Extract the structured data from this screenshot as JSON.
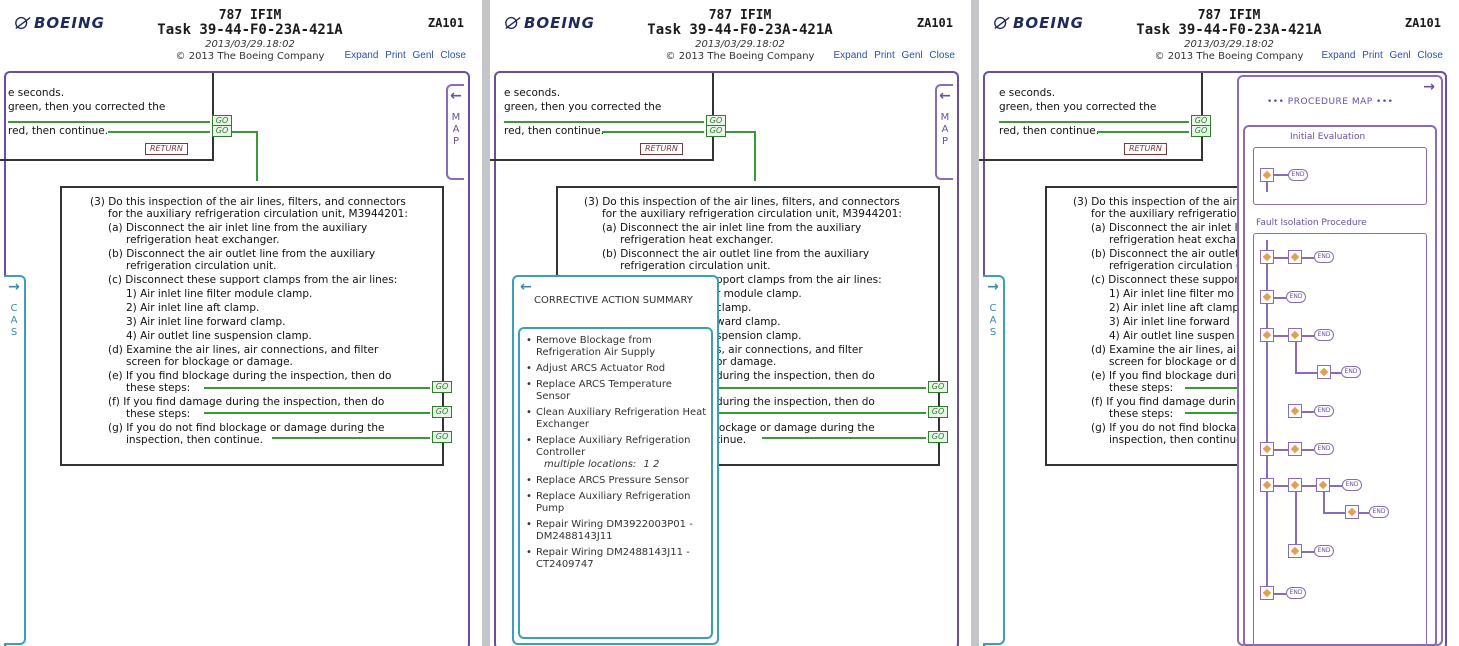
{
  "header": {
    "logo": "BOEING",
    "app_title": "787 IFIM",
    "task": "Task 39-44-F0-23A-421A",
    "date": "2013/03/29.18:02",
    "copyright": "© 2013 The Boeing Company",
    "id": "ZA101",
    "nav": [
      "Expand",
      "Print",
      "Genl",
      "Close"
    ]
  },
  "flow": {
    "line1": "e seconds.",
    "line2": "green, then you corrected the",
    "line3": "red, then continue.",
    "go": "GO",
    "return": "RETURN"
  },
  "step": {
    "s3a": "(3) Do this inspection of the air lines, filters, and connectors",
    "s3b": "for the auxiliary refrigeration circulation unit, M3944201:",
    "a1": "(a) Disconnect the air inlet line from the auxiliary",
    "a2": "refrigeration heat exchanger.",
    "b1": "(b) Disconnect the air outlet line from the auxiliary",
    "b2": "refrigeration circulation unit.",
    "c1": "(c) Disconnect these support clamps from the air lines:",
    "c_i1": "1) Air inlet line filter module clamp.",
    "c_i2": "2) Air inlet line aft clamp.",
    "c_i3": "3) Air inlet line forward clamp.",
    "c_i4": "4) Air outlet line suspension clamp.",
    "d1": "(d) Examine the air lines, air connections, and filter",
    "d2": "screen for blockage or damage.",
    "e1": "(e) If you find blockage during the inspection, then do",
    "e2": "these steps:",
    "f1": "(f) If you find damage during the inspection, then do",
    "f2": "these steps:",
    "g1": "(g) If you do not find blockage or damage during the",
    "g2": "inspection, then continue."
  },
  "p2step": {
    "c1": "pport clamps from the air lines:",
    "ci1": "r module clamp.",
    "ci2": "clamp.",
    "ci3": "ward clamp.",
    "ci4": "spension clamp.",
    "d1": "s, air connections, and filter",
    "d2": "or damage.",
    "e1": "during the inspection, then do",
    "f1": "during the inspection, then do",
    "g1": "lockage or damage during the",
    "g2": "tinue."
  },
  "p3step": {
    "s3a": "(3) Do this inspection of the air",
    "s3b": "for the auxiliary refrigeratio",
    "a1": "(a) Disconnect the air inlet li",
    "a2": "refrigeration heat exchar",
    "b1": "(b) Disconnect the air outlet",
    "b2": "refrigeration circulation (",
    "c1": "(c) Disconnect these suppor",
    "c_i1": "1) Air inlet line filter mo",
    "c_i2": "2) Air inlet line aft clamp",
    "c_i3": "3) Air inlet line forward",
    "c_i4": "4) Air outlet line suspen",
    "d1": "(d) Examine the air lines, ai",
    "d2": "screen for blockage or d",
    "e1": "(e) If you find blockage duri",
    "e2": "these steps:",
    "f1": "(f) If you find damage durin",
    "f2": "these steps:",
    "g1": "(g) If you do not find blocka",
    "g2": "inspection, then continue"
  },
  "tabs": {
    "map": [
      "M",
      "A",
      "P"
    ],
    "cas": [
      "C",
      "A",
      "S"
    ],
    "arrow_left": "←",
    "arrow_right": "→"
  },
  "cas_panel": {
    "title": "CORRECTIVE ACTION SUMMARY",
    "items": [
      "Remove Blockage from Refrigeration Air Supply",
      "Adjust ARCS Actuator Rod",
      "Replace ARCS Temperature Sensor",
      "Clean Auxiliary Refrigeration Heat Exchanger",
      "Replace Auxiliary Refrigeration Controller",
      "Replace ARCS Pressure Sensor",
      "Replace Auxiliary Refrigeration Pump",
      "Repair Wiring DM3922003P01 - DM2488143J11",
      "Repair Wiring DM2488143J11 - CT2409747"
    ],
    "multiple_label": "multiple locations:",
    "multiple_links": "1   2"
  },
  "map_panel": {
    "title": "••• PROCEDURE MAP •••",
    "sec1": "Initial Evaluation",
    "sec2": "Fault Isolation Procedure",
    "end": "END"
  }
}
